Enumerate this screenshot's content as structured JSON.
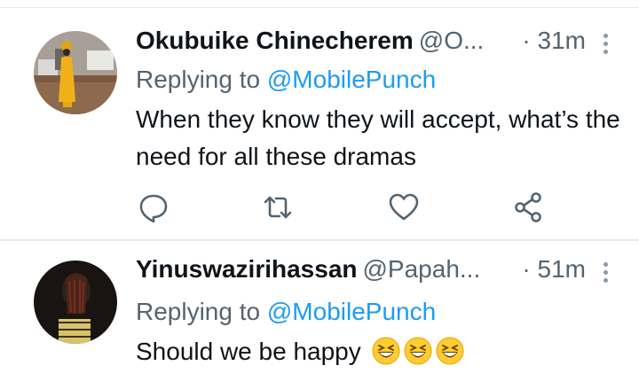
{
  "tweets": [
    {
      "name": "Okubuike Chinecherem",
      "handle": "@O...",
      "time": "· 31m",
      "replying_prefix": "Replying to ",
      "replying_to": "@MobilePunch",
      "text": "When they know they will accept, what’s the need for all these dramas",
      "avatar_icon": "user-photo-woman-yellow-dress"
    },
    {
      "name": "Yinuswazirihassan",
      "handle": "@Papah...",
      "time": "· 51m",
      "replying_prefix": "Replying to ",
      "replying_to": "@MobilePunch",
      "text": "Should we be happy",
      "emojis": [
        "grinning-squinting-face",
        "grinning-squinting-face",
        "grinning-squinting-face"
      ],
      "avatar_icon": "user-photo-dark"
    }
  ],
  "actions": [
    "reply-icon",
    "retweet-icon",
    "like-icon",
    "share-icon"
  ],
  "colors": {
    "link": "#1d9bf0",
    "secondary": "#536471",
    "icon": "#536471",
    "text": "#0f1419"
  }
}
